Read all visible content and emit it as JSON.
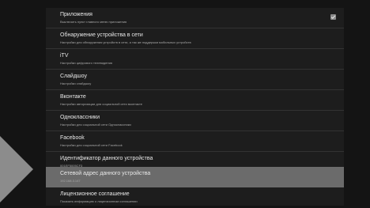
{
  "settings": {
    "items": [
      {
        "title": "Приложения",
        "subtitle": "Выключить пункт главного меню приложения",
        "checked": true
      },
      {
        "title": "Обнаружение устройства в сети",
        "subtitle": "Настройки для обнаружения устройств в сети, а так же поддержки мобильных устройств"
      },
      {
        "title": "iTV",
        "subtitle": "Настройки цифрового телевидения"
      },
      {
        "title": "Слайдшоу",
        "subtitle": "Настройки слайдшоу"
      },
      {
        "title": "Вконтакте",
        "subtitle": "Настройки авторизации для социальной сети вконтакте"
      },
      {
        "title": "Одноклассники",
        "subtitle": "Настройки для социальной сети Одноклассники"
      },
      {
        "title": "Facebook",
        "subtitle": "Настройки для социальной сети Facebook"
      },
      {
        "title": "Идентификатор данного устройства",
        "subtitle": "001EF5005CF3"
      },
      {
        "title": "Сетевой адрес данного устройства",
        "subtitle": "192.168.3.147",
        "selected": true
      },
      {
        "title": "Лицензионное соглашение",
        "subtitle": "Показать информацию о лицензионном соглашении"
      }
    ]
  }
}
